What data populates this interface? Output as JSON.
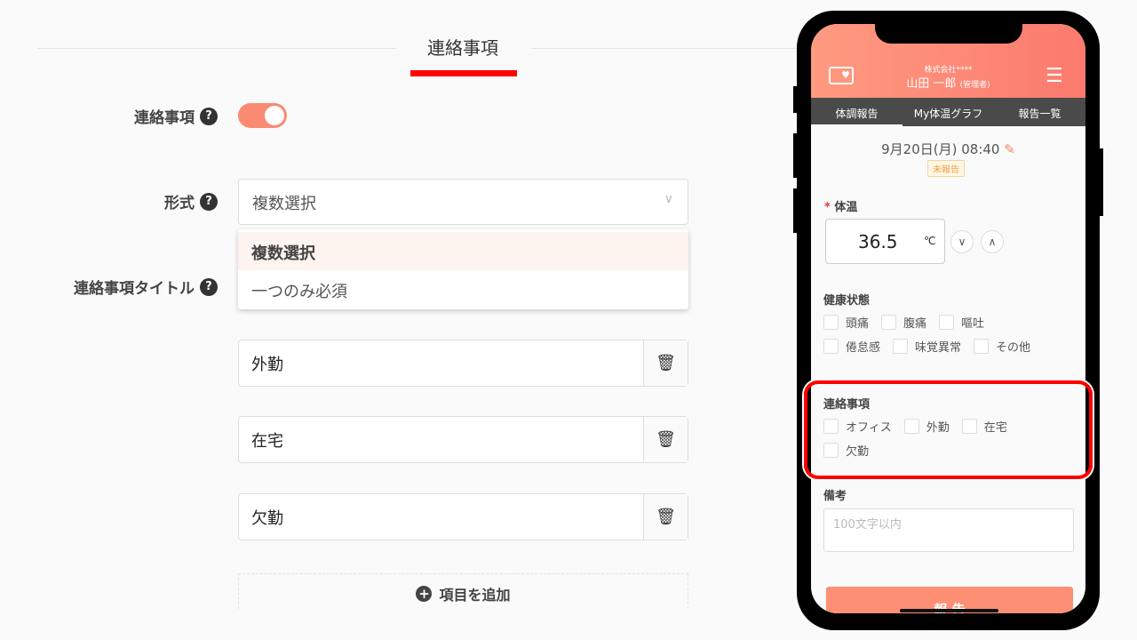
{
  "section": {
    "title": "連絡事項"
  },
  "form": {
    "toggle_label": "連絡事項",
    "toggle_on": true,
    "format_label": "形式",
    "format_value": "複数選択",
    "format_options": [
      "複数選択",
      "一つのみ必須"
    ],
    "title_label": "連絡事項タイトル",
    "items": [
      "外勤",
      "在宅",
      "欠勤"
    ],
    "add_label": "項目を追加",
    "help": "?",
    "chevron": "∨",
    "trash": "🗑",
    "plus": "+"
  },
  "phone": {
    "company": "株式会社****",
    "user": "山田 一郎",
    "role": "(管理者)",
    "menu": "☰",
    "tabs": [
      "体調報告",
      "My体温グラフ",
      "報告一覧"
    ],
    "date": "9月20日(月) 08:40",
    "edit": "✎",
    "status": "未報告",
    "temp_label": "体温",
    "required": "*",
    "temp_value": "36.5",
    "temp_unit": "℃",
    "down": "∨",
    "up": "∧",
    "health_label": "健康状態",
    "health": [
      "頭痛",
      "腹痛",
      "嘔吐",
      "倦怠感",
      "味覚異常",
      "その他"
    ],
    "contact_label": "連絡事項",
    "contact": [
      "オフィス",
      "外勤",
      "在宅",
      "欠勤"
    ],
    "note_label": "備考",
    "note_placeholder": "100文字以内",
    "submit": "報 告"
  },
  "colors": {
    "accent": "#fa8b72",
    "highlight": "#ff0000",
    "tabbar": "#4a4a4a"
  }
}
